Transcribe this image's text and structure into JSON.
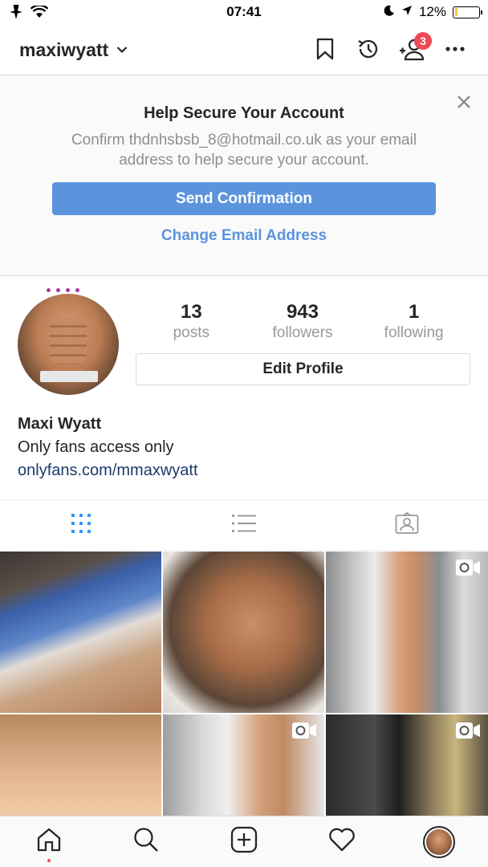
{
  "status_bar": {
    "time": "07:41",
    "battery": "12%",
    "battery_level": 0.12
  },
  "header": {
    "username": "maxiwyatt",
    "notification_count": "3"
  },
  "banner": {
    "title": "Help Secure Your Account",
    "body": "Confirm thdnhsbsb_8@hotmail.co.uk as your email address to help secure your account.",
    "send_button": "Send Confirmation",
    "change_link": "Change Email Address"
  },
  "profile": {
    "posts_count": "13",
    "posts_label": "posts",
    "followers_count": "943",
    "followers_label": "followers",
    "following_count": "1",
    "following_label": "following",
    "edit_button": "Edit Profile",
    "full_name": "Maxi Wyatt",
    "bio": "Only fans access only",
    "link": "onlyfans.com/mmaxwyatt"
  },
  "tabs": [
    "grid-icon",
    "list-icon",
    "tagged-icon"
  ],
  "posts": [
    {
      "video": false
    },
    {
      "video": false
    },
    {
      "video": true
    },
    {
      "video": false
    },
    {
      "video": true
    },
    {
      "video": true
    }
  ],
  "bottom_nav": [
    "home-icon",
    "search-icon",
    "add-post-icon",
    "heart-icon",
    "profile-avatar"
  ],
  "colors": {
    "accent": "#5b94dd",
    "badge": "#ed4956",
    "link": "#1b3a6b"
  }
}
